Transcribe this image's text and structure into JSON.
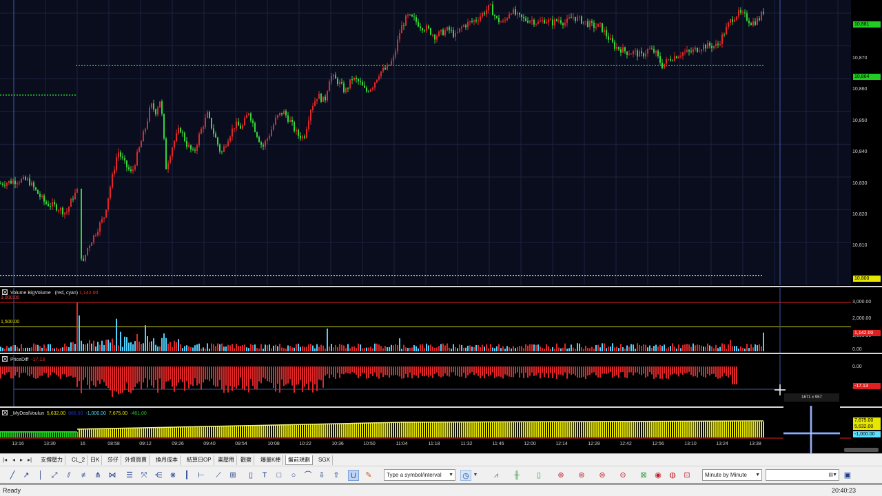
{
  "main_chart": {
    "y_ticks": [
      "10,870",
      "10,860",
      "10,850",
      "10,840",
      "10,830",
      "10,820",
      "10,810"
    ],
    "tags": [
      {
        "text": "10,881",
        "color": "#22cc22"
      },
      {
        "text": "10,864",
        "color": "#22cc22"
      },
      {
        "text": "10,800",
        "color": "#e6e600"
      }
    ]
  },
  "volume_pane": {
    "title": "Volume BigVolume",
    "params": "(red, cyan)",
    "value": "1,142.00",
    "ref_high_label": "3,000.00",
    "ref_low_label": "1,500.00",
    "y_ticks": [
      "3,000.00",
      "2,000.00",
      "1,000.00",
      "0.00"
    ],
    "tag": "1,142.00"
  },
  "pricediff_pane": {
    "title": "PriceDiff",
    "value": "-17.13",
    "y_ticks": [
      "0.00",
      "-20.00"
    ],
    "tag": "-17.13"
  },
  "deal_pane": {
    "title": "_MyDealVoulun",
    "v1": "5,632.00",
    "v2": "866.00",
    "v3": "-1,000.00",
    "v4": "7,675.00",
    "v5": "-461.00",
    "tags": [
      "7,675.00",
      "5,632.00",
      "-1,000.00"
    ]
  },
  "time_axis": {
    "labels": [
      "13:16",
      "13:30",
      "16",
      "08:58",
      "09:12",
      "09:26",
      "09:40",
      "09:54",
      "10:08",
      "10:22",
      "10:36",
      "10:50",
      "11:04",
      "11:18",
      "11:32",
      "11:46",
      "12:00",
      "12:14",
      "12:28",
      "12:42",
      "12:56",
      "13:10",
      "13:24",
      "13:38"
    ]
  },
  "tabs": [
    "支撐壓力",
    "CL_2",
    "日K",
    "莎仔",
    "外資買賣",
    "換月成本",
    "結算日OP",
    "畫壓用",
    "觀察",
    "爆量K棒",
    "盤前規劃",
    "SGX"
  ],
  "active_tab": "盤前規劃",
  "toolbar": {
    "symbol_placeholder": "Type a symbol/interval",
    "interval": "Minute by Minute"
  },
  "crosshair_dims": "1671 x 957",
  "status": {
    "text": "Ready",
    "time": "20:40:23"
  },
  "chart_data": {
    "type": "candlestick",
    "price_range": [
      10797,
      10884
    ],
    "reference_lines": [
      10855,
      10864,
      10800
    ],
    "close_path": [
      [
        0,
        10828
      ],
      [
        25,
        10829
      ],
      [
        40,
        10829
      ],
      [
        50,
        10826
      ],
      [
        65,
        10822
      ],
      [
        80,
        10821
      ],
      [
        95,
        10819
      ],
      [
        105,
        10824
      ],
      [
        112,
        10826
      ],
      [
        118,
        10802
      ],
      [
        125,
        10808
      ],
      [
        135,
        10812
      ],
      [
        150,
        10818
      ],
      [
        160,
        10828
      ],
      [
        170,
        10838
      ],
      [
        180,
        10834
      ],
      [
        190,
        10831
      ],
      [
        200,
        10838
      ],
      [
        210,
        10845
      ],
      [
        218,
        10852
      ],
      [
        225,
        10850
      ],
      [
        232,
        10854
      ],
      [
        240,
        10833
      ],
      [
        250,
        10840
      ],
      [
        260,
        10845
      ],
      [
        270,
        10840
      ],
      [
        280,
        10837
      ],
      [
        290,
        10844
      ],
      [
        300,
        10849
      ],
      [
        310,
        10843
      ],
      [
        320,
        10837
      ],
      [
        330,
        10842
      ],
      [
        340,
        10846
      ],
      [
        350,
        10845
      ],
      [
        360,
        10850
      ],
      [
        370,
        10844
      ],
      [
        380,
        10839
      ],
      [
        390,
        10843
      ],
      [
        400,
        10848
      ],
      [
        410,
        10850
      ],
      [
        420,
        10847
      ],
      [
        430,
        10843
      ],
      [
        440,
        10842
      ],
      [
        450,
        10851
      ],
      [
        460,
        10855
      ],
      [
        470,
        10853
      ],
      [
        478,
        10861
      ],
      [
        490,
        10859
      ],
      [
        500,
        10856
      ],
      [
        510,
        10860
      ],
      [
        520,
        10859
      ],
      [
        530,
        10856
      ],
      [
        540,
        10858
      ],
      [
        550,
        10862
      ],
      [
        560,
        10863
      ],
      [
        570,
        10866
      ],
      [
        580,
        10875
      ],
      [
        590,
        10879
      ],
      [
        600,
        10878
      ],
      [
        610,
        10876
      ],
      [
        620,
        10875
      ],
      [
        630,
        10873
      ],
      [
        640,
        10874
      ],
      [
        650,
        10875
      ],
      [
        660,
        10873
      ],
      [
        670,
        10876
      ],
      [
        680,
        10877
      ],
      [
        690,
        10878
      ],
      [
        700,
        10880
      ],
      [
        710,
        10882
      ],
      [
        720,
        10878
      ],
      [
        730,
        10877
      ],
      [
        740,
        10881
      ],
      [
        750,
        10879
      ],
      [
        760,
        10878
      ],
      [
        770,
        10878
      ],
      [
        780,
        10877
      ],
      [
        790,
        10878
      ],
      [
        800,
        10877
      ],
      [
        810,
        10878
      ],
      [
        820,
        10877
      ],
      [
        830,
        10879
      ],
      [
        840,
        10878
      ],
      [
        850,
        10877
      ],
      [
        860,
        10876
      ],
      [
        870,
        10876
      ],
      [
        880,
        10873
      ],
      [
        890,
        10870
      ],
      [
        900,
        10869
      ],
      [
        910,
        10868
      ],
      [
        920,
        10868
      ],
      [
        930,
        10867
      ],
      [
        940,
        10869
      ],
      [
        950,
        10868
      ],
      [
        960,
        10864
      ],
      [
        970,
        10866
      ],
      [
        980,
        10867
      ],
      [
        990,
        10868
      ],
      [
        1000,
        10868
      ],
      [
        1010,
        10869
      ],
      [
        1020,
        10870
      ],
      [
        1030,
        10870
      ],
      [
        1040,
        10870
      ],
      [
        1050,
        10874
      ],
      [
        1060,
        10878
      ],
      [
        1070,
        10880
      ],
      [
        1080,
        10879
      ],
      [
        1090,
        10877
      ],
      [
        1100,
        10878
      ],
      [
        1108,
        10881
      ]
    ],
    "volume_max": 3000,
    "pricediff_range": [
      -25,
      0
    ]
  }
}
